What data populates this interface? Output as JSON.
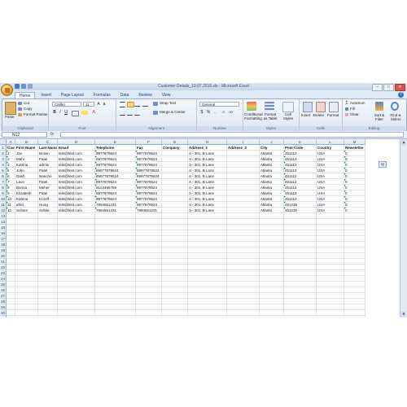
{
  "window": {
    "title": "Customer Details_10.07.2016.xls - Microsoft Excel"
  },
  "tabs": [
    "Home",
    "Insert",
    "Page Layout",
    "Formulas",
    "Data",
    "Review",
    "View"
  ],
  "ribbon": {
    "clipboard": {
      "label": "Clipboard",
      "paste": "Paste",
      "cut": "Cut",
      "copy": "Copy",
      "format_painter": "Format Painter"
    },
    "font": {
      "label": "Font",
      "font_name": "Calibri",
      "font_size": "11"
    },
    "alignment": {
      "label": "Alignment",
      "wrap": "Wrap Text",
      "merge": "Merge & Center"
    },
    "number": {
      "label": "Number",
      "format": "General"
    },
    "styles": {
      "label": "Styles",
      "conditional": "Conditional Formatting",
      "format_table": "Format as Table",
      "cell_styles": "Cell Styles"
    },
    "cells": {
      "label": "Cells",
      "insert": "Insert",
      "delete": "Delete",
      "format": "Format"
    },
    "editing": {
      "label": "Editing",
      "autosum": "AutoSum",
      "fill": "Fill",
      "clear": "Clear",
      "sort": "Sort & Filter",
      "find": "Find & Select"
    }
  },
  "formula_bar": {
    "name_box": "N12",
    "fx": "fx",
    "value": ""
  },
  "sheet": {
    "columns": [
      "A",
      "B",
      "C",
      "D",
      "E",
      "F",
      "G",
      "H",
      "I",
      "J",
      "K",
      "L",
      "M"
    ],
    "headers": [
      "Customer ID",
      "First Name",
      "Last Name",
      "Email",
      "Telephone",
      "Fax",
      "Company",
      "Address_1",
      "Address_2",
      "City",
      "Post Code",
      "Country",
      "Newsletter"
    ],
    "rows": [
      [
        "1",
        "Jax",
        "Brown",
        "test@test.com",
        "9977879524",
        "9977879524",
        "",
        "A - 301, B Lane",
        "",
        "Atlanta",
        "451113",
        "USA",
        "0"
      ],
      [
        "2",
        "Mahi",
        "Patel",
        "test@test.com",
        "9977879524",
        "9977879524",
        "",
        "A - 301, B Lane",
        "",
        "Atlanta",
        "451113",
        "USA",
        "0"
      ],
      [
        "3",
        "Katrina",
        "admin",
        "test@test.com",
        "9977879524",
        "9977879524",
        "",
        "A - 301, B Lane",
        "",
        "Atlanta",
        "451113",
        "USA",
        "0"
      ],
      [
        "5",
        "John",
        "Patel",
        "test@test.com",
        "89977879524",
        "89977879524",
        "",
        "A - 301, B Lane",
        "",
        "Atlanta",
        "451113",
        "USA",
        "0"
      ],
      [
        "6",
        "Dash",
        "Nancho",
        "test@test.com",
        "89977879524",
        "89977879524",
        "",
        "A - 301, B Lane",
        "",
        "Atlanta",
        "451112",
        "USA",
        "0"
      ],
      [
        "7",
        "Laon",
        "Patel",
        "test@test.com",
        "9977879524",
        "9977879524",
        "",
        "A - 301, B Lane",
        "",
        "Atlanta",
        "451113",
        "USA",
        "0"
      ],
      [
        "8",
        "Bonna",
        "Meher",
        "test@test.com",
        "8123456789",
        "9977879524",
        "",
        "A - 301, B Lane",
        "",
        "Atlanta",
        "451113",
        "USA",
        "0"
      ],
      [
        "9",
        "Elizabeth",
        "Patel",
        "test@test.com",
        "9977879524",
        "9977879524",
        "",
        "A - 301, B Lane",
        "",
        "Atlanta",
        "451113",
        "USA",
        "0"
      ],
      [
        "10",
        "Katrina",
        "Krooff",
        "test@test.com",
        "9977879524",
        "9977879524",
        "",
        "A - 301, B Lane",
        "",
        "Atlanta",
        "451113",
        "USA",
        "0"
      ],
      [
        "11",
        "afrid",
        "Hung",
        "test@test.com",
        "7894561231",
        "9977879524",
        "",
        "A - 301, B Lane",
        "",
        "Atlanta",
        "451236",
        "USA",
        "0"
      ],
      [
        "12",
        "Soham",
        "Sohila",
        "test@test.com",
        "7894561231",
        "7894561231",
        "",
        "A - 301, B Lane",
        "",
        "Atlanta",
        "451236",
        "USA",
        "0"
      ]
    ],
    "row_numbers": [
      "1",
      "2",
      "3",
      "4",
      "5",
      "6",
      "7",
      "8",
      "9",
      "10",
      "11",
      "12",
      "13",
      "14",
      "15",
      "16",
      "17",
      "18",
      "19",
      "20",
      "21",
      "22",
      "23",
      "24",
      "25",
      "26",
      "27",
      "28",
      "29",
      "30",
      "31"
    ]
  },
  "colors": {
    "ribbon_bg": "#dce7f5",
    "header_bg": "#dce6f3",
    "accent": "#15428b",
    "text_marker": "#2e8b3d"
  }
}
